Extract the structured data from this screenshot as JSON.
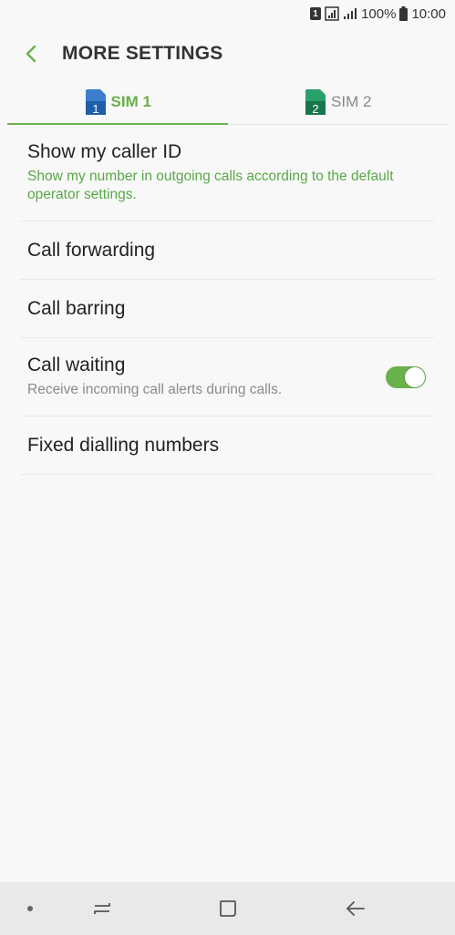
{
  "status_bar": {
    "sim_badge": "1",
    "battery_text": "100%",
    "time": "10:00"
  },
  "header": {
    "title": "MORE SETTINGS"
  },
  "tabs": [
    {
      "label": "SIM 1",
      "sim_number": "1",
      "active": true,
      "color": "#2f6db5"
    },
    {
      "label": "SIM 2",
      "sim_number": "2",
      "active": false,
      "color": "#1f8a55"
    }
  ],
  "settings": {
    "caller_id": {
      "title": "Show my caller ID",
      "subtitle": "Show my number in outgoing calls according to the default operator settings."
    },
    "call_forwarding": {
      "title": "Call forwarding"
    },
    "call_barring": {
      "title": "Call barring"
    },
    "call_waiting": {
      "title": "Call waiting",
      "subtitle": "Receive incoming call alerts during calls.",
      "enabled": true
    },
    "fixed_dialling": {
      "title": "Fixed dialling numbers"
    }
  },
  "colors": {
    "accent": "#6ab04c",
    "background": "#f8f8f8"
  }
}
